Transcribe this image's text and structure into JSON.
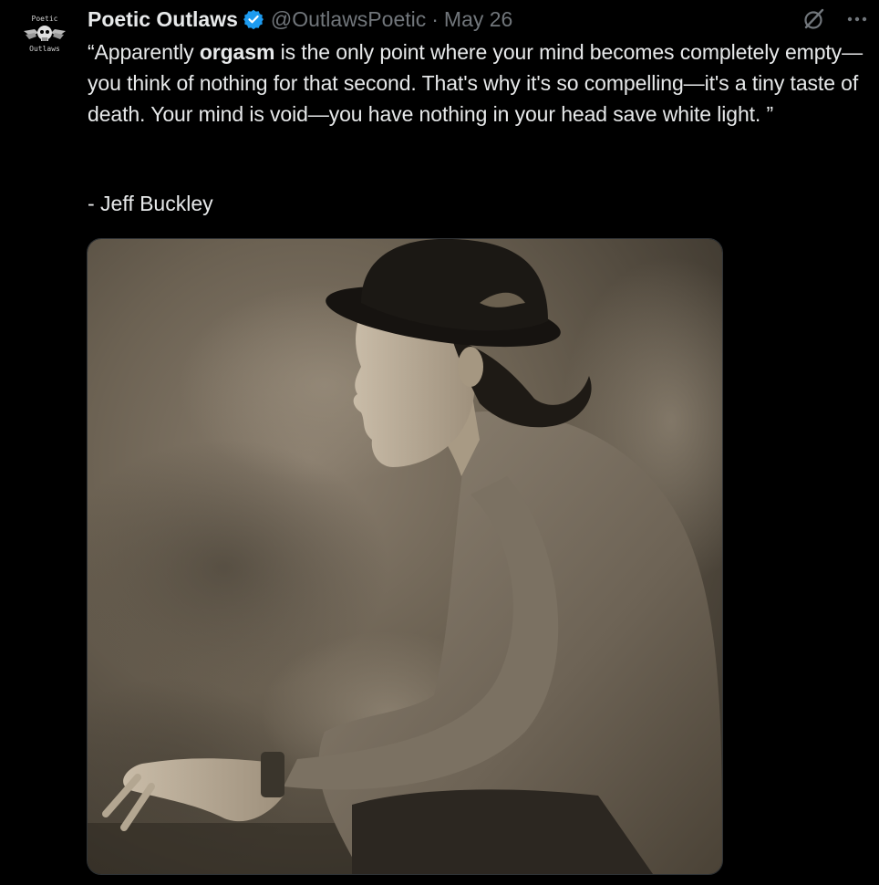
{
  "tweet": {
    "author": {
      "display_name": "Poetic Outlaws",
      "handle": "@OutlawsPoetic",
      "avatar_text_top": "Poetic",
      "avatar_text_bottom": "Outlaws",
      "verified": true
    },
    "separator": "·",
    "date": "May 26",
    "text_prefix": "“Apparently ",
    "text_bold": "orgasm",
    "text_suffix": " is the only point where your mind becomes completely empty—you think of nothing for that second. That's why it's so compelling—it's a tiny taste of death. Your mind is void—you have nothing in your head save white light. ”",
    "attribution": "- Jeff Buckley",
    "media": {
      "type": "photo",
      "subject": "sepia portrait of man in hat, seated in profile"
    }
  },
  "icons": {
    "verified": "verified-badge-icon",
    "grok": "grok-icon",
    "more": "more-options-icon"
  },
  "colors": {
    "background": "#000000",
    "text_primary": "#e7e9ea",
    "text_secondary": "#71767b",
    "verified_blue": "#1d9bf0"
  }
}
